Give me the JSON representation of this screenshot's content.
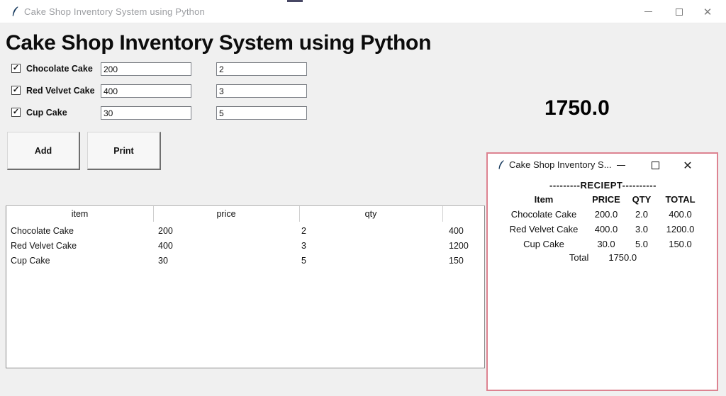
{
  "window": {
    "title": "Cake Shop Inventory System using Python",
    "close_glyph": "✕"
  },
  "heading": "Cake Shop Inventory System using Python",
  "icons": {
    "check": "✓",
    "app": "python-feather"
  },
  "items": [
    {
      "label": "Chocolate Cake",
      "checked": true,
      "price": "200",
      "qty": "2"
    },
    {
      "label": "Red Velvet Cake",
      "checked": true,
      "price": "400",
      "qty": "3"
    },
    {
      "label": "Cup Cake",
      "checked": true,
      "price": "30",
      "qty": "5"
    }
  ],
  "total_display": "1750.0",
  "buttons": {
    "add": "Add",
    "print": "Print"
  },
  "table": {
    "headers": [
      "item",
      "price",
      "qty"
    ],
    "rows": [
      [
        "Chocolate Cake",
        "200",
        "2",
        "400"
      ],
      [
        "Red Velvet Cake",
        "400",
        "3",
        "1200"
      ],
      [
        "Cup Cake",
        "30",
        "5",
        "150"
      ]
    ]
  },
  "popup": {
    "title": "Cake Shop Inventory S...",
    "close_glyph": "✕",
    "receipt_header": "---------RECIEPT----------",
    "columns": [
      "Item",
      "PRICE",
      "QTY",
      "TOTAL"
    ],
    "rows": [
      [
        "Chocolate Cake",
        "200.0",
        "2.0",
        "400.0"
      ],
      [
        "Red Velvet Cake",
        "400.0",
        "3.0",
        "1200.0"
      ],
      [
        "Cup Cake",
        "30.0",
        "5.0",
        "150.0"
      ]
    ],
    "total_label": "Total",
    "total_value": "1750.0",
    "border_color": "#dd8391"
  }
}
